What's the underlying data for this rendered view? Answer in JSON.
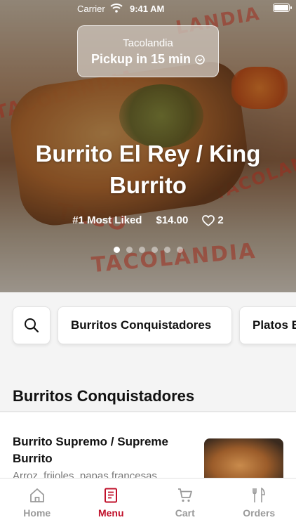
{
  "status_bar": {
    "carrier": "Carrier",
    "time": "9:41 AM"
  },
  "hero": {
    "store_name": "Tacolandia",
    "pickup_label": "Pickup in 15 min",
    "title": "Burrito El Rey / King Burrito",
    "badge": "#1 Most Liked",
    "price": "$14.00",
    "likes": "2",
    "slide_count": 6,
    "active_slide": 1,
    "paper_text": [
      "TACOLANDIA",
      "TACOLANDIA",
      "TACOLANDIA",
      "TACO",
      "LANDIA"
    ]
  },
  "categories": {
    "items": [
      "Burritos Conquistadores",
      "Platos Especiales"
    ]
  },
  "section": {
    "title": "Burritos Conquistadores"
  },
  "menu_item": {
    "name": "Burrito Supremo / Supreme Burrito",
    "description": "Arroz, frijoles, papas francesas,"
  },
  "tabbar": {
    "tabs": [
      {
        "label": "Home",
        "icon": "home-icon"
      },
      {
        "label": "Menu",
        "icon": "menu-icon"
      },
      {
        "label": "Cart",
        "icon": "cart-icon"
      },
      {
        "label": "Orders",
        "icon": "orders-icon"
      }
    ],
    "active": "Menu"
  },
  "colors": {
    "accent": "#c0102a",
    "inactive": "#9a9a9a"
  }
}
